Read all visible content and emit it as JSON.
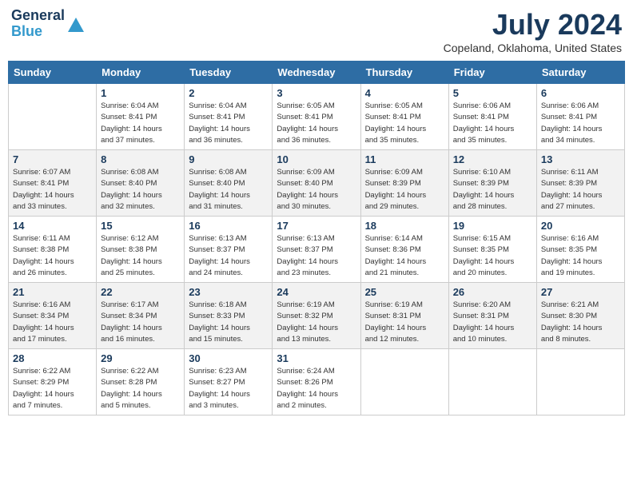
{
  "logo": {
    "general": "General",
    "blue": "Blue"
  },
  "header": {
    "month_year": "July 2024",
    "location": "Copeland, Oklahoma, United States"
  },
  "days_of_week": [
    "Sunday",
    "Monday",
    "Tuesday",
    "Wednesday",
    "Thursday",
    "Friday",
    "Saturday"
  ],
  "weeks": [
    [
      {
        "day": "",
        "info": ""
      },
      {
        "day": "1",
        "info": "Sunrise: 6:04 AM\nSunset: 8:41 PM\nDaylight: 14 hours\nand 37 minutes."
      },
      {
        "day": "2",
        "info": "Sunrise: 6:04 AM\nSunset: 8:41 PM\nDaylight: 14 hours\nand 36 minutes."
      },
      {
        "day": "3",
        "info": "Sunrise: 6:05 AM\nSunset: 8:41 PM\nDaylight: 14 hours\nand 36 minutes."
      },
      {
        "day": "4",
        "info": "Sunrise: 6:05 AM\nSunset: 8:41 PM\nDaylight: 14 hours\nand 35 minutes."
      },
      {
        "day": "5",
        "info": "Sunrise: 6:06 AM\nSunset: 8:41 PM\nDaylight: 14 hours\nand 35 minutes."
      },
      {
        "day": "6",
        "info": "Sunrise: 6:06 AM\nSunset: 8:41 PM\nDaylight: 14 hours\nand 34 minutes."
      }
    ],
    [
      {
        "day": "7",
        "info": "Sunrise: 6:07 AM\nSunset: 8:41 PM\nDaylight: 14 hours\nand 33 minutes."
      },
      {
        "day": "8",
        "info": "Sunrise: 6:08 AM\nSunset: 8:40 PM\nDaylight: 14 hours\nand 32 minutes."
      },
      {
        "day": "9",
        "info": "Sunrise: 6:08 AM\nSunset: 8:40 PM\nDaylight: 14 hours\nand 31 minutes."
      },
      {
        "day": "10",
        "info": "Sunrise: 6:09 AM\nSunset: 8:40 PM\nDaylight: 14 hours\nand 30 minutes."
      },
      {
        "day": "11",
        "info": "Sunrise: 6:09 AM\nSunset: 8:39 PM\nDaylight: 14 hours\nand 29 minutes."
      },
      {
        "day": "12",
        "info": "Sunrise: 6:10 AM\nSunset: 8:39 PM\nDaylight: 14 hours\nand 28 minutes."
      },
      {
        "day": "13",
        "info": "Sunrise: 6:11 AM\nSunset: 8:39 PM\nDaylight: 14 hours\nand 27 minutes."
      }
    ],
    [
      {
        "day": "14",
        "info": "Sunrise: 6:11 AM\nSunset: 8:38 PM\nDaylight: 14 hours\nand 26 minutes."
      },
      {
        "day": "15",
        "info": "Sunrise: 6:12 AM\nSunset: 8:38 PM\nDaylight: 14 hours\nand 25 minutes."
      },
      {
        "day": "16",
        "info": "Sunrise: 6:13 AM\nSunset: 8:37 PM\nDaylight: 14 hours\nand 24 minutes."
      },
      {
        "day": "17",
        "info": "Sunrise: 6:13 AM\nSunset: 8:37 PM\nDaylight: 14 hours\nand 23 minutes."
      },
      {
        "day": "18",
        "info": "Sunrise: 6:14 AM\nSunset: 8:36 PM\nDaylight: 14 hours\nand 21 minutes."
      },
      {
        "day": "19",
        "info": "Sunrise: 6:15 AM\nSunset: 8:35 PM\nDaylight: 14 hours\nand 20 minutes."
      },
      {
        "day": "20",
        "info": "Sunrise: 6:16 AM\nSunset: 8:35 PM\nDaylight: 14 hours\nand 19 minutes."
      }
    ],
    [
      {
        "day": "21",
        "info": "Sunrise: 6:16 AM\nSunset: 8:34 PM\nDaylight: 14 hours\nand 17 minutes."
      },
      {
        "day": "22",
        "info": "Sunrise: 6:17 AM\nSunset: 8:34 PM\nDaylight: 14 hours\nand 16 minutes."
      },
      {
        "day": "23",
        "info": "Sunrise: 6:18 AM\nSunset: 8:33 PM\nDaylight: 14 hours\nand 15 minutes."
      },
      {
        "day": "24",
        "info": "Sunrise: 6:19 AM\nSunset: 8:32 PM\nDaylight: 14 hours\nand 13 minutes."
      },
      {
        "day": "25",
        "info": "Sunrise: 6:19 AM\nSunset: 8:31 PM\nDaylight: 14 hours\nand 12 minutes."
      },
      {
        "day": "26",
        "info": "Sunrise: 6:20 AM\nSunset: 8:31 PM\nDaylight: 14 hours\nand 10 minutes."
      },
      {
        "day": "27",
        "info": "Sunrise: 6:21 AM\nSunset: 8:30 PM\nDaylight: 14 hours\nand 8 minutes."
      }
    ],
    [
      {
        "day": "28",
        "info": "Sunrise: 6:22 AM\nSunset: 8:29 PM\nDaylight: 14 hours\nand 7 minutes."
      },
      {
        "day": "29",
        "info": "Sunrise: 6:22 AM\nSunset: 8:28 PM\nDaylight: 14 hours\nand 5 minutes."
      },
      {
        "day": "30",
        "info": "Sunrise: 6:23 AM\nSunset: 8:27 PM\nDaylight: 14 hours\nand 3 minutes."
      },
      {
        "day": "31",
        "info": "Sunrise: 6:24 AM\nSunset: 8:26 PM\nDaylight: 14 hours\nand 2 minutes."
      },
      {
        "day": "",
        "info": ""
      },
      {
        "day": "",
        "info": ""
      },
      {
        "day": "",
        "info": ""
      }
    ]
  ]
}
